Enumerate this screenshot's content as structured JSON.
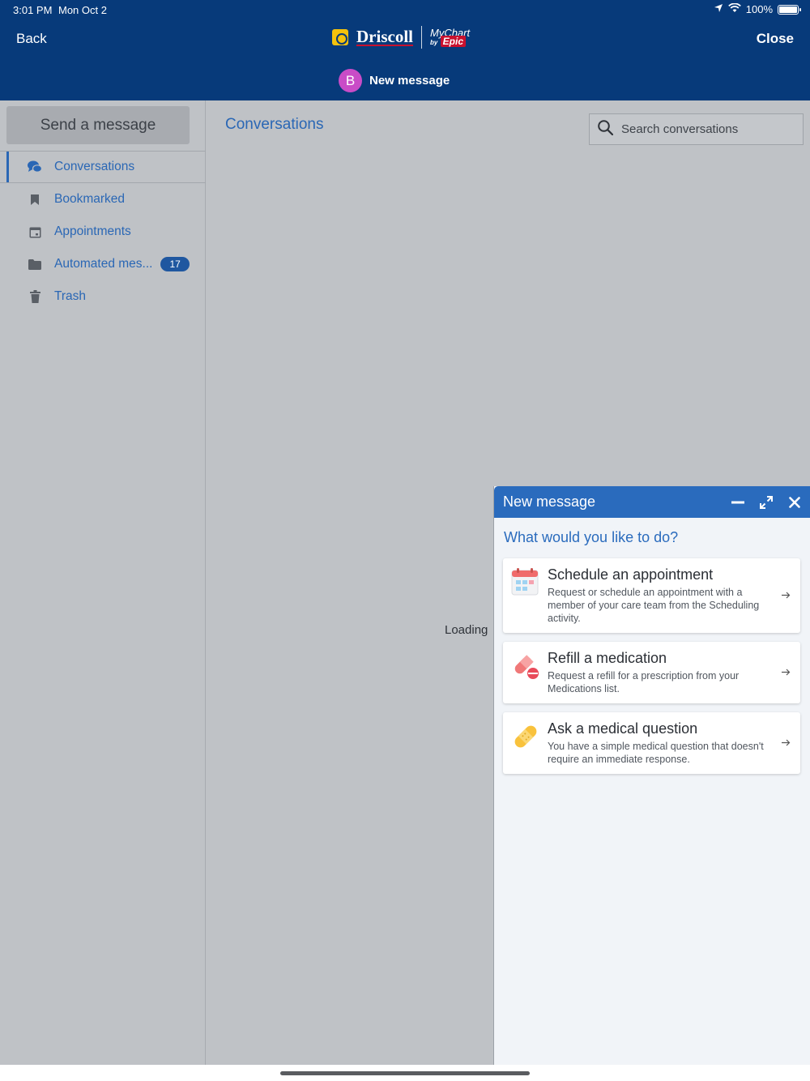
{
  "status_bar": {
    "time": "3:01 PM",
    "date": "Mon Oct 2",
    "battery": "100%"
  },
  "header": {
    "back_label": "Back",
    "close_label": "Close",
    "brand_name": "Driscoll",
    "brand_product": "MyChart",
    "brand_by": "by",
    "brand_epic": "Epic",
    "avatar_initial": "B",
    "title": "New message"
  },
  "sidebar": {
    "send_label": "Send a message",
    "items": [
      {
        "label": "Conversations",
        "icon": "chat-bubbles-icon",
        "active": true
      },
      {
        "label": "Bookmarked",
        "icon": "bookmark-icon"
      },
      {
        "label": "Appointments",
        "icon": "calendar-icon"
      },
      {
        "label": "Automated mes...",
        "icon": "folder-icon",
        "badge": "17"
      },
      {
        "label": "Trash",
        "icon": "trash-icon"
      }
    ]
  },
  "content": {
    "title": "Conversations",
    "search_placeholder": "Search conversations",
    "loading": "Loading"
  },
  "panel": {
    "title": "New message",
    "prompt": "What would you like to do?",
    "options": [
      {
        "title": "Schedule an appointment",
        "desc": "Request or schedule an appointment with a member of your care team from the Scheduling activity.",
        "icon": "calendar-color-icon"
      },
      {
        "title": "Refill a medication",
        "desc": "Request a refill for a prescription from your Medications list.",
        "icon": "pill-icon"
      },
      {
        "title": "Ask a medical question",
        "desc": "You have a simple medical question that doesn't require an immediate response.",
        "icon": "bandage-icon"
      }
    ]
  },
  "colors": {
    "header_bg": "#073a7a",
    "accent": "#2a6bbd",
    "panel_head": "#2a6bbd",
    "avatar": "#c94cc7",
    "badge": "#1f57a0"
  }
}
